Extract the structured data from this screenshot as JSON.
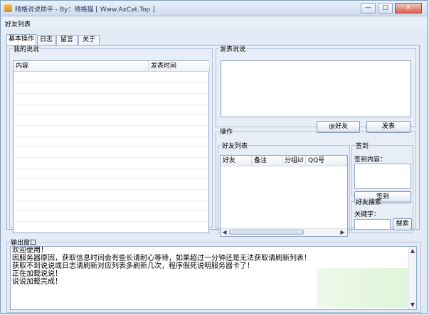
{
  "window": {
    "title": "晴格说说助手 - By：晴格猫 [ Www.AxCat.Top ]",
    "minimize": "—",
    "maximize": "□",
    "close": "✕"
  },
  "menubar": {
    "label": "好友列表"
  },
  "tabs": [
    {
      "label": "基本操作",
      "active": true
    },
    {
      "label": "日志"
    },
    {
      "label": "留言"
    },
    {
      "label": "关于"
    }
  ],
  "my_posts": {
    "legend": "我的说说",
    "columns": [
      "内容",
      "发表时间"
    ]
  },
  "post_box": {
    "legend": "发表说说",
    "at_friend_button": "@好友",
    "post_button": "发表"
  },
  "operations": {
    "legend": "操作",
    "friend_list": {
      "legend": "好友列表",
      "columns": [
        "好友",
        "备注",
        "分组id",
        "QQ号"
      ]
    },
    "checkin": {
      "legend": "签到",
      "content_label": "签到内容：",
      "button": "签到"
    },
    "friend_search": {
      "legend": "好友搜索",
      "keyword_label": "关键字：",
      "search_button": "搜索"
    }
  },
  "output": {
    "legend": "输出窗口",
    "lines": [
      "欢迎使用！",
      "因服务器原因，获取信息时间会有些长请耐心等待，如果超过一分钟还是无法获取请刷新列表！",
      "获取不到说说或日志请刷新对应列表多刷新几次，程序假死说明服务器卡了！",
      "正在加载说说！",
      "说说加载完成！"
    ]
  },
  "colors": {
    "accent": "#3a6ea5",
    "watermark_green": "#7fd26b"
  }
}
